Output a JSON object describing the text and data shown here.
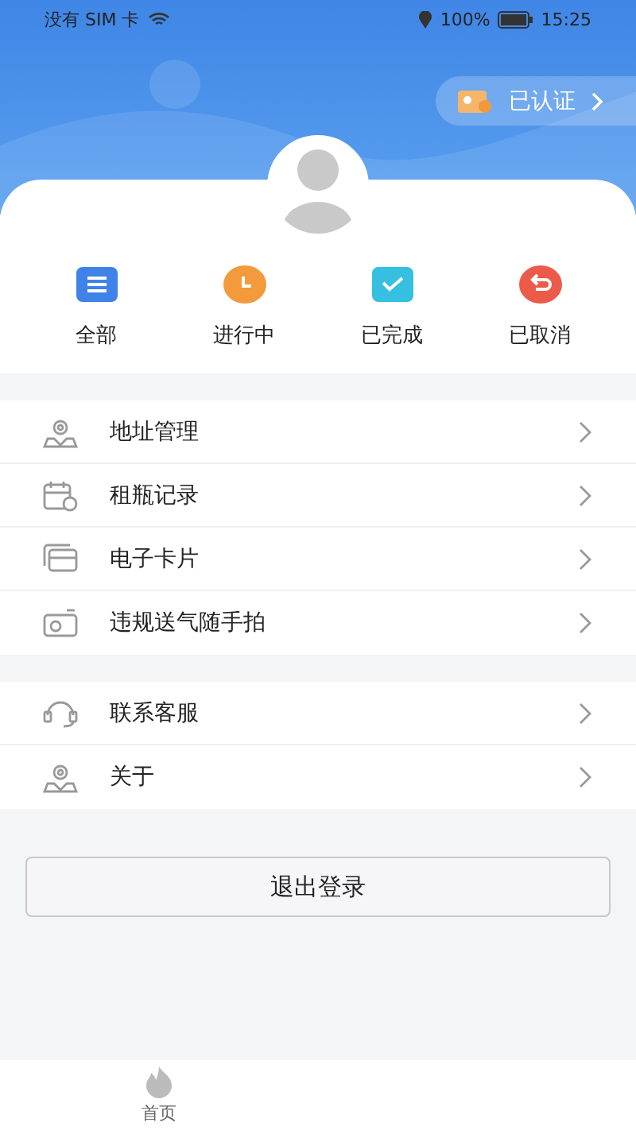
{
  "status_bar": {
    "carrier": "没有 SIM 卡",
    "battery": "100%",
    "time": "15:25"
  },
  "verify_badge": {
    "label": "已认证"
  },
  "order_tabs": [
    {
      "kind": "all",
      "label": "全部"
    },
    {
      "kind": "ongoing",
      "label": "进行中"
    },
    {
      "kind": "done",
      "label": "已完成"
    },
    {
      "kind": "cancelled",
      "label": "已取消"
    }
  ],
  "menu_groups": [
    [
      {
        "kind": "address",
        "label": "地址管理"
      },
      {
        "kind": "rental",
        "label": "租瓶记录"
      },
      {
        "kind": "card",
        "label": "电子卡片"
      },
      {
        "kind": "camera",
        "label": "违规送气随手拍"
      }
    ],
    [
      {
        "kind": "service",
        "label": "联系客服"
      },
      {
        "kind": "about",
        "label": "关于"
      }
    ]
  ],
  "logout_button": "退出登录",
  "bottom_tabs": [
    {
      "label": "首页",
      "selected": false
    }
  ]
}
